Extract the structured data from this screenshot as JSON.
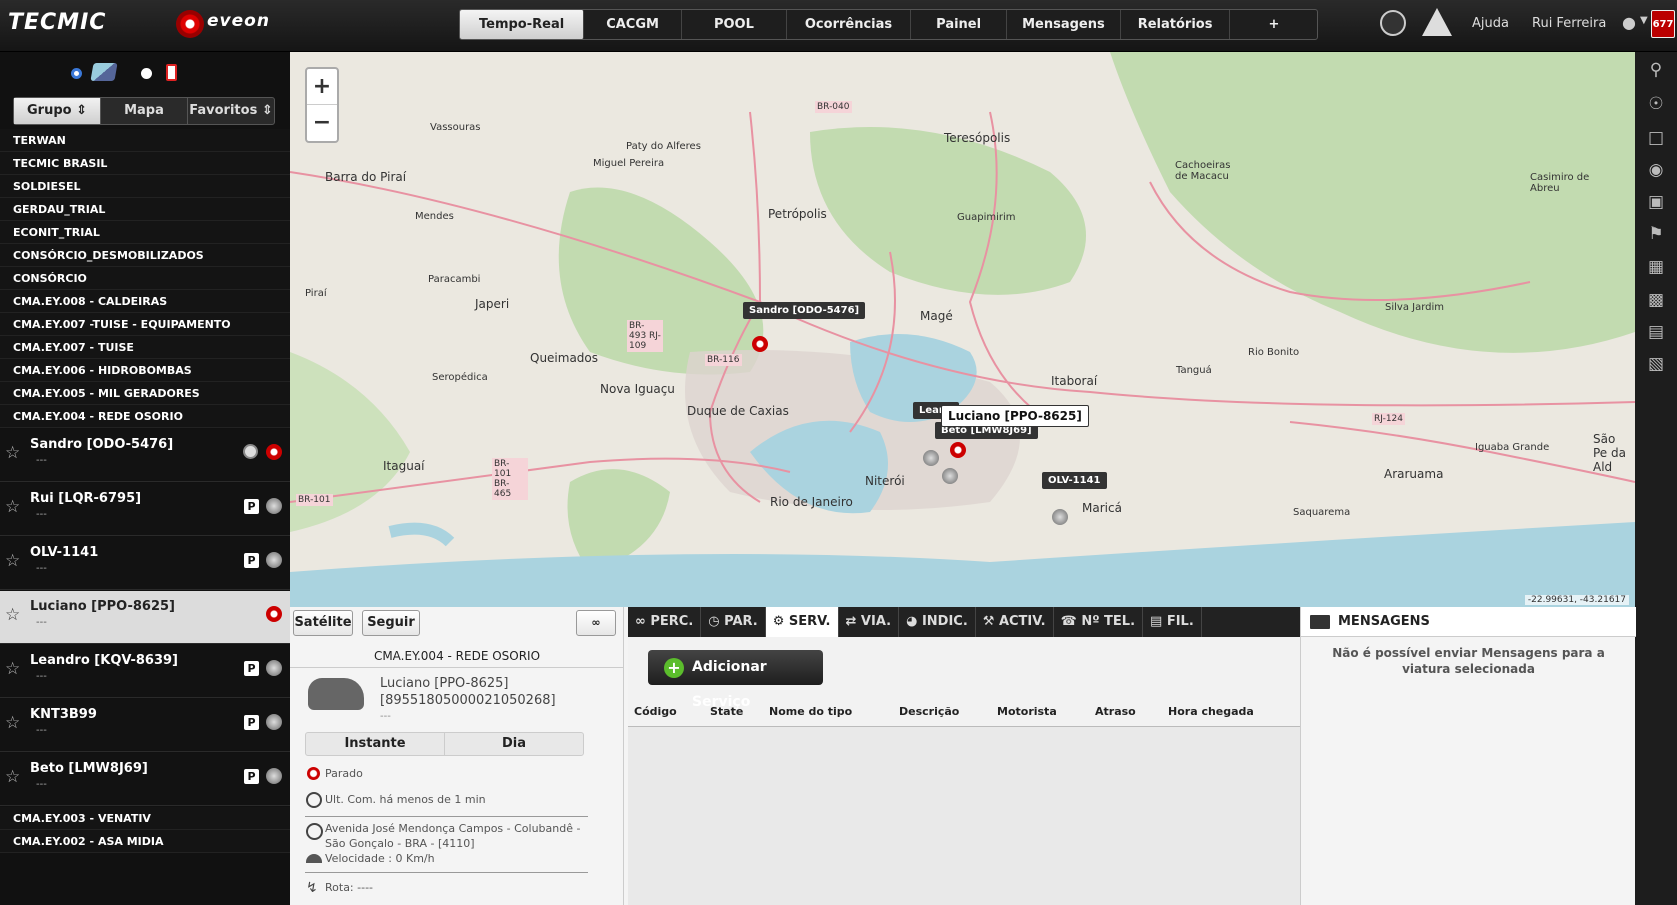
{
  "header": {
    "brand1": "TECMIC",
    "brand2": "eveon",
    "tabs": [
      "Tempo-Real",
      "CACGM",
      "POOL",
      "Ocorrências",
      "Painel",
      "Mensagens",
      "Relatórios",
      "+"
    ],
    "active_tab": "Tempo-Real",
    "help": "Ajuda",
    "user": "Rui Ferreira",
    "counter": "677"
  },
  "sidebar": {
    "tabs": [
      "Grupo",
      "Mapa",
      "Favoritos"
    ],
    "groups_top": [
      "TERWAN",
      "TECMIC BRASIL",
      "SOLDIESEL",
      "GERDAU_TRIAL",
      "ECONIT_TRIAL",
      "CONSÓRCIO_DESMOBILIZADOS",
      "CONSÓRCIO",
      "CMA.EY.008 - CALDEIRAS",
      "CMA.EY.007 -TUISE - EQUIPAMENTO",
      "CMA.EY.007 - TUISE",
      "CMA.EY.006 - HIDROBOMBAS",
      "CMA.EY.005 - MIL GERADORES",
      "CMA.EY.004 - REDE OSORIO"
    ],
    "vehicles": [
      {
        "name": "Sandro [ODO-5476]",
        "sub": "---",
        "status": "red"
      },
      {
        "name": "Rui [LQR-6795]",
        "sub": "---",
        "status": "P"
      },
      {
        "name": "OLV-1141",
        "sub": "---",
        "status": "P"
      },
      {
        "name": "Luciano [PPO-8625]",
        "sub": "---",
        "status": "red"
      },
      {
        "name": "Leandro [KQV-8639]",
        "sub": "---",
        "status": "P"
      },
      {
        "name": "KNT3B99",
        "sub": "---",
        "status": "P"
      },
      {
        "name": "Beto [LMW8J69]",
        "sub": "---",
        "status": "P"
      }
    ],
    "groups_bottom": [
      "CMA.EY.003 - VENATIV",
      "CMA.EY.002 - ASA MIDIA"
    ],
    "p_label": "P"
  },
  "map": {
    "places": [
      "Vassouras",
      "Paty do Alferes",
      "Miguel Pereira",
      "Barra do Piraí",
      "Mendes",
      "Petrópolis",
      "Teresópolis",
      "Guapimirim",
      "Paracambi",
      "Japeri",
      "Queimados",
      "Nova Iguaçu",
      "Duque de Caxias",
      "Magé",
      "Itaboraí",
      "Seropédica",
      "Itaguaí",
      "Rio de Janeiro",
      "Niterói",
      "Maricá",
      "Araruama",
      "Saquarema",
      "Iguaba Grande",
      "Silva Jardim",
      "Rio Bonito",
      "Tanguá",
      "Cachoeiras de Macacu",
      "Casimiro de Abreu",
      "Piraí",
      "São Pe da Ald"
    ],
    "roads": [
      "BR-040",
      "BR-493 RJ-109",
      "BR-101 BR-465",
      "BR-101",
      "RJ-124",
      "BR-116"
    ],
    "coords": "-22.99631, -43.21617",
    "pins": {
      "sandro": "Sandro [ODO-5476]",
      "luciano": "Luciano [PPO-8625]",
      "beto": "Beto [LMW8J69]",
      "leandro": "Leand",
      "olv": "OLV-1141"
    }
  },
  "detail": {
    "btn_satellite": "Satélite",
    "btn_follow": "Seguir",
    "group": "CMA.EY.004 - REDE OSORIO",
    "vehicle": "Luciano [PPO-8625]",
    "id": "[89551805000021050268]",
    "dash": "---",
    "tab_instant": "Instante",
    "tab_day": "Dia",
    "status": "Parado",
    "last_com": "Ult. Com. há menos de 1 min",
    "address": "Avenida José Mendonça Campos - Colubandê - São Gonçalo - BRA - [4110]",
    "speed": "Velocidade : 0 Km/h",
    "route": "Rota: ----"
  },
  "services": {
    "tabs": [
      "PERC.",
      "PAR.",
      "SERV.",
      "VIA.",
      "INDIC.",
      "ACTIV.",
      "Nº TEL.",
      "FIL."
    ],
    "active": "SERV.",
    "add_button": "Adicionar Serviço",
    "columns": [
      "Código",
      "State",
      "Nome do tipo",
      "Descrição",
      "Motorista",
      "Atraso",
      "Hora chegada"
    ]
  },
  "messages": {
    "title": "MENSAGENS",
    "text": "Não é possível enviar Mensagens para a viatura selecionada"
  }
}
